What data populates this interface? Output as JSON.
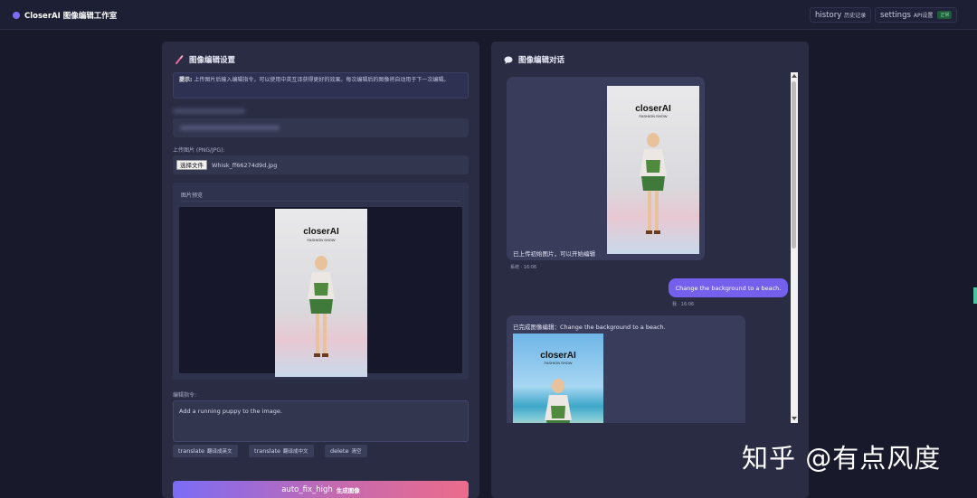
{
  "header": {
    "title": "CloserAI 图像编辑工作室",
    "history": {
      "icon": "history",
      "label": "历史记录"
    },
    "settings": {
      "icon": "settings",
      "label": "API设置",
      "badge": "正常"
    }
  },
  "left_panel": {
    "title": "图像编辑设置",
    "title_icon": "brush-icon",
    "tip_label": "提示:",
    "tip_text": "上传图片后输入编辑指令，可以使用中英互译获得更好的效果。每次编辑后的图像将自动用于下一次编辑。",
    "upload_label": "上传图片 (PNG/JPG):",
    "file_button": "选择文件",
    "file_name": "Whisk_ff66274d9d.jpg",
    "preview_title": "图片预览",
    "preview_image": {
      "brand": "closerAI",
      "sub": "FASHION SHOW"
    },
    "instruction_label": "编辑指令:",
    "instruction_value": "Add a running puppy to the image.",
    "buttons": [
      {
        "icon": "translate",
        "label": "翻译成英文"
      },
      {
        "icon": "translate",
        "label": "翻译成中文"
      },
      {
        "icon": "delete",
        "label": "清空"
      }
    ],
    "generate": {
      "icon": "auto_fix_high",
      "label": "生成图像"
    }
  },
  "right_panel": {
    "title": "图像编辑对话",
    "title_icon": "chat-bubble-icon",
    "messages": [
      {
        "role": "system",
        "text": "已上传初始图片，可以开始编辑",
        "image_brand": "closerAI",
        "image_sub": "FASHION SHOW",
        "time": "系统 · 16:06"
      },
      {
        "role": "user",
        "text": "Change the background to a beach.",
        "time": "我 · 16:06"
      },
      {
        "role": "system",
        "text": "已完成图像编辑：Change the background to a beach.",
        "image_brand": "closerAI",
        "image_sub": "FASHION SHOW"
      }
    ]
  },
  "watermark": "知乎 @有点风度",
  "colors": {
    "accent": "#7c6cf2",
    "user_bubble": "#7560ee",
    "gradient_start": "#7b6cf6",
    "gradient_end": "#ec6c8c"
  }
}
